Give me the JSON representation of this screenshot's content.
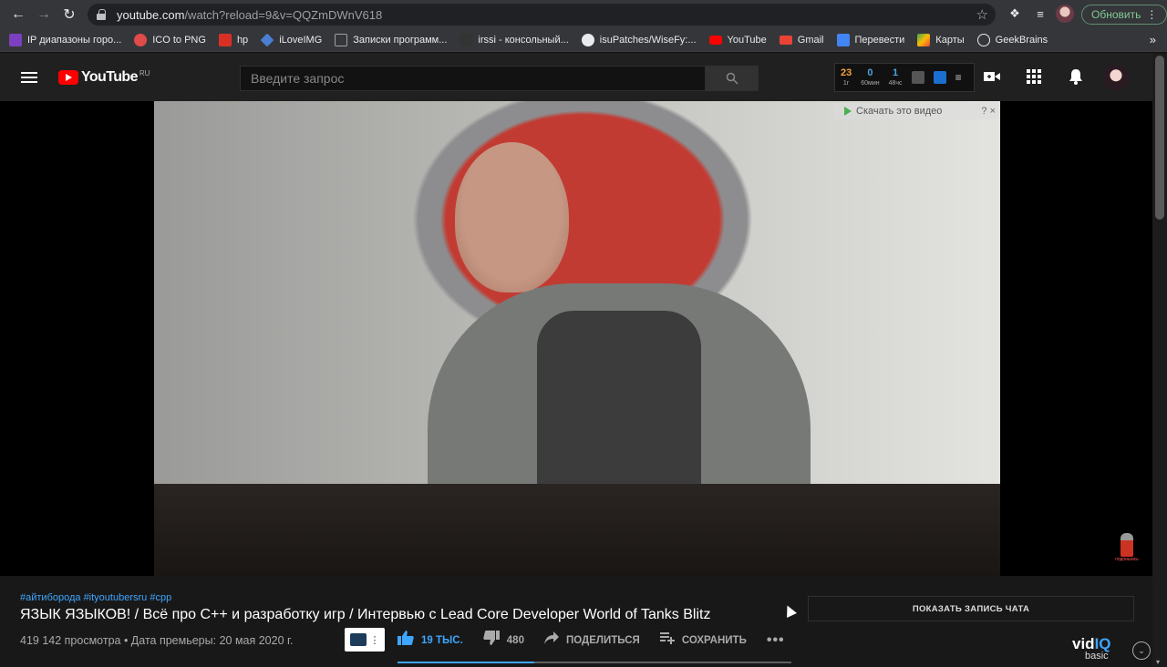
{
  "browser": {
    "url_host": "youtube.com",
    "url_path": "/watch?reload=9&v=QQZmDWnV618",
    "update_label": "Обновить",
    "bookmarks": [
      {
        "label": "IP диапазоны горо...",
        "color": "#7b3fbf"
      },
      {
        "label": "ICO to PNG",
        "color": "#e04b4b"
      },
      {
        "label": "hp",
        "color": "#d93025"
      },
      {
        "label": "iLoveIMG",
        "color": "#4a7fd4"
      },
      {
        "label": "Записки программ...",
        "color": "#9aa0a6"
      },
      {
        "label": "irssi - консольный...",
        "color": "#333333"
      },
      {
        "label": "isuPatches/WiseFy:...",
        "color": "#e8eaed"
      },
      {
        "label": "YouTube",
        "color": "#ff0000"
      },
      {
        "label": "Gmail",
        "color": "#ea4335"
      },
      {
        "label": "Перевести",
        "color": "#4285f4"
      },
      {
        "label": "Карты",
        "color": "#34a853"
      },
      {
        "label": "GeekBrains",
        "color": "#e8eaed"
      }
    ],
    "bookmarks_more": "»"
  },
  "header": {
    "logo_word": "YouTube",
    "logo_region": "RU",
    "search_placeholder": "Введите запрос",
    "vidiq_stats": [
      {
        "num": "23",
        "label": "1г"
      },
      {
        "num": "0",
        "label": "60мин"
      },
      {
        "num": "1",
        "label": "48чс"
      }
    ]
  },
  "video": {
    "download_overlay": "Скачать это видео",
    "download_close": "? ×",
    "subscribe_badge": "подпишись"
  },
  "info": {
    "tags": "#айтиборода #ityoutubersru #cpp",
    "title": "ЯЗЫК ЯЗЫКОВ! / Всё про C++ и разработку игр / Интервью с Lead Core Developer World of Tanks Blitz",
    "meta": "419 142 просмотра • Дата премьеры: 20 мая 2020 г.",
    "likes": "19 ТЫС.",
    "dislikes": "480",
    "share_label": "ПОДЕЛИТЬСЯ",
    "save_label": "СОХРАНИТЬ",
    "more_label": "•••",
    "chat_button": "ПОКАЗАТЬ ЗАПИСЬ ЧАТА",
    "vidiq_word_vid": "vid",
    "vidiq_word_iq": "IQ",
    "vidiq_plan": "basic"
  }
}
